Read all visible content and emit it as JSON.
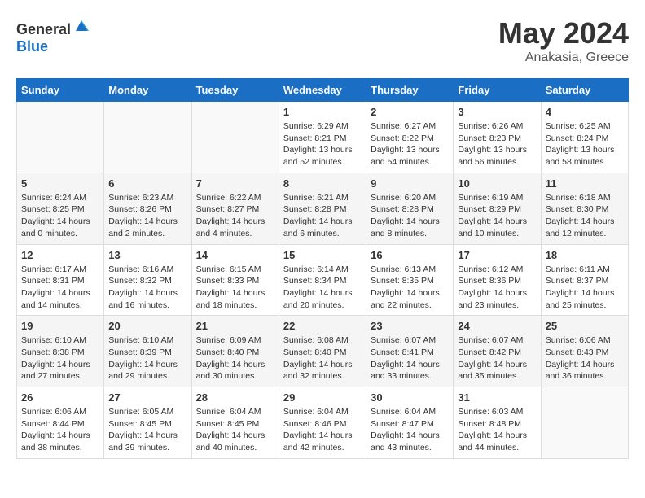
{
  "header": {
    "logo_general": "General",
    "logo_blue": "Blue",
    "month_year": "May 2024",
    "location": "Anakasia, Greece"
  },
  "days_of_week": [
    "Sunday",
    "Monday",
    "Tuesday",
    "Wednesday",
    "Thursday",
    "Friday",
    "Saturday"
  ],
  "weeks": [
    [
      {
        "day": "",
        "sunrise": "",
        "sunset": "",
        "daylight": ""
      },
      {
        "day": "",
        "sunrise": "",
        "sunset": "",
        "daylight": ""
      },
      {
        "day": "",
        "sunrise": "",
        "sunset": "",
        "daylight": ""
      },
      {
        "day": "1",
        "sunrise": "Sunrise: 6:29 AM",
        "sunset": "Sunset: 8:21 PM",
        "daylight": "Daylight: 13 hours and 52 minutes."
      },
      {
        "day": "2",
        "sunrise": "Sunrise: 6:27 AM",
        "sunset": "Sunset: 8:22 PM",
        "daylight": "Daylight: 13 hours and 54 minutes."
      },
      {
        "day": "3",
        "sunrise": "Sunrise: 6:26 AM",
        "sunset": "Sunset: 8:23 PM",
        "daylight": "Daylight: 13 hours and 56 minutes."
      },
      {
        "day": "4",
        "sunrise": "Sunrise: 6:25 AM",
        "sunset": "Sunset: 8:24 PM",
        "daylight": "Daylight: 13 hours and 58 minutes."
      }
    ],
    [
      {
        "day": "5",
        "sunrise": "Sunrise: 6:24 AM",
        "sunset": "Sunset: 8:25 PM",
        "daylight": "Daylight: 14 hours and 0 minutes."
      },
      {
        "day": "6",
        "sunrise": "Sunrise: 6:23 AM",
        "sunset": "Sunset: 8:26 PM",
        "daylight": "Daylight: 14 hours and 2 minutes."
      },
      {
        "day": "7",
        "sunrise": "Sunrise: 6:22 AM",
        "sunset": "Sunset: 8:27 PM",
        "daylight": "Daylight: 14 hours and 4 minutes."
      },
      {
        "day": "8",
        "sunrise": "Sunrise: 6:21 AM",
        "sunset": "Sunset: 8:28 PM",
        "daylight": "Daylight: 14 hours and 6 minutes."
      },
      {
        "day": "9",
        "sunrise": "Sunrise: 6:20 AM",
        "sunset": "Sunset: 8:28 PM",
        "daylight": "Daylight: 14 hours and 8 minutes."
      },
      {
        "day": "10",
        "sunrise": "Sunrise: 6:19 AM",
        "sunset": "Sunset: 8:29 PM",
        "daylight": "Daylight: 14 hours and 10 minutes."
      },
      {
        "day": "11",
        "sunrise": "Sunrise: 6:18 AM",
        "sunset": "Sunset: 8:30 PM",
        "daylight": "Daylight: 14 hours and 12 minutes."
      }
    ],
    [
      {
        "day": "12",
        "sunrise": "Sunrise: 6:17 AM",
        "sunset": "Sunset: 8:31 PM",
        "daylight": "Daylight: 14 hours and 14 minutes."
      },
      {
        "day": "13",
        "sunrise": "Sunrise: 6:16 AM",
        "sunset": "Sunset: 8:32 PM",
        "daylight": "Daylight: 14 hours and 16 minutes."
      },
      {
        "day": "14",
        "sunrise": "Sunrise: 6:15 AM",
        "sunset": "Sunset: 8:33 PM",
        "daylight": "Daylight: 14 hours and 18 minutes."
      },
      {
        "day": "15",
        "sunrise": "Sunrise: 6:14 AM",
        "sunset": "Sunset: 8:34 PM",
        "daylight": "Daylight: 14 hours and 20 minutes."
      },
      {
        "day": "16",
        "sunrise": "Sunrise: 6:13 AM",
        "sunset": "Sunset: 8:35 PM",
        "daylight": "Daylight: 14 hours and 22 minutes."
      },
      {
        "day": "17",
        "sunrise": "Sunrise: 6:12 AM",
        "sunset": "Sunset: 8:36 PM",
        "daylight": "Daylight: 14 hours and 23 minutes."
      },
      {
        "day": "18",
        "sunrise": "Sunrise: 6:11 AM",
        "sunset": "Sunset: 8:37 PM",
        "daylight": "Daylight: 14 hours and 25 minutes."
      }
    ],
    [
      {
        "day": "19",
        "sunrise": "Sunrise: 6:10 AM",
        "sunset": "Sunset: 8:38 PM",
        "daylight": "Daylight: 14 hours and 27 minutes."
      },
      {
        "day": "20",
        "sunrise": "Sunrise: 6:10 AM",
        "sunset": "Sunset: 8:39 PM",
        "daylight": "Daylight: 14 hours and 29 minutes."
      },
      {
        "day": "21",
        "sunrise": "Sunrise: 6:09 AM",
        "sunset": "Sunset: 8:40 PM",
        "daylight": "Daylight: 14 hours and 30 minutes."
      },
      {
        "day": "22",
        "sunrise": "Sunrise: 6:08 AM",
        "sunset": "Sunset: 8:40 PM",
        "daylight": "Daylight: 14 hours and 32 minutes."
      },
      {
        "day": "23",
        "sunrise": "Sunrise: 6:07 AM",
        "sunset": "Sunset: 8:41 PM",
        "daylight": "Daylight: 14 hours and 33 minutes."
      },
      {
        "day": "24",
        "sunrise": "Sunrise: 6:07 AM",
        "sunset": "Sunset: 8:42 PM",
        "daylight": "Daylight: 14 hours and 35 minutes."
      },
      {
        "day": "25",
        "sunrise": "Sunrise: 6:06 AM",
        "sunset": "Sunset: 8:43 PM",
        "daylight": "Daylight: 14 hours and 36 minutes."
      }
    ],
    [
      {
        "day": "26",
        "sunrise": "Sunrise: 6:06 AM",
        "sunset": "Sunset: 8:44 PM",
        "daylight": "Daylight: 14 hours and 38 minutes."
      },
      {
        "day": "27",
        "sunrise": "Sunrise: 6:05 AM",
        "sunset": "Sunset: 8:45 PM",
        "daylight": "Daylight: 14 hours and 39 minutes."
      },
      {
        "day": "28",
        "sunrise": "Sunrise: 6:04 AM",
        "sunset": "Sunset: 8:45 PM",
        "daylight": "Daylight: 14 hours and 40 minutes."
      },
      {
        "day": "29",
        "sunrise": "Sunrise: 6:04 AM",
        "sunset": "Sunset: 8:46 PM",
        "daylight": "Daylight: 14 hours and 42 minutes."
      },
      {
        "day": "30",
        "sunrise": "Sunrise: 6:04 AM",
        "sunset": "Sunset: 8:47 PM",
        "daylight": "Daylight: 14 hours and 43 minutes."
      },
      {
        "day": "31",
        "sunrise": "Sunrise: 6:03 AM",
        "sunset": "Sunset: 8:48 PM",
        "daylight": "Daylight: 14 hours and 44 minutes."
      },
      {
        "day": "",
        "sunrise": "",
        "sunset": "",
        "daylight": ""
      }
    ]
  ]
}
